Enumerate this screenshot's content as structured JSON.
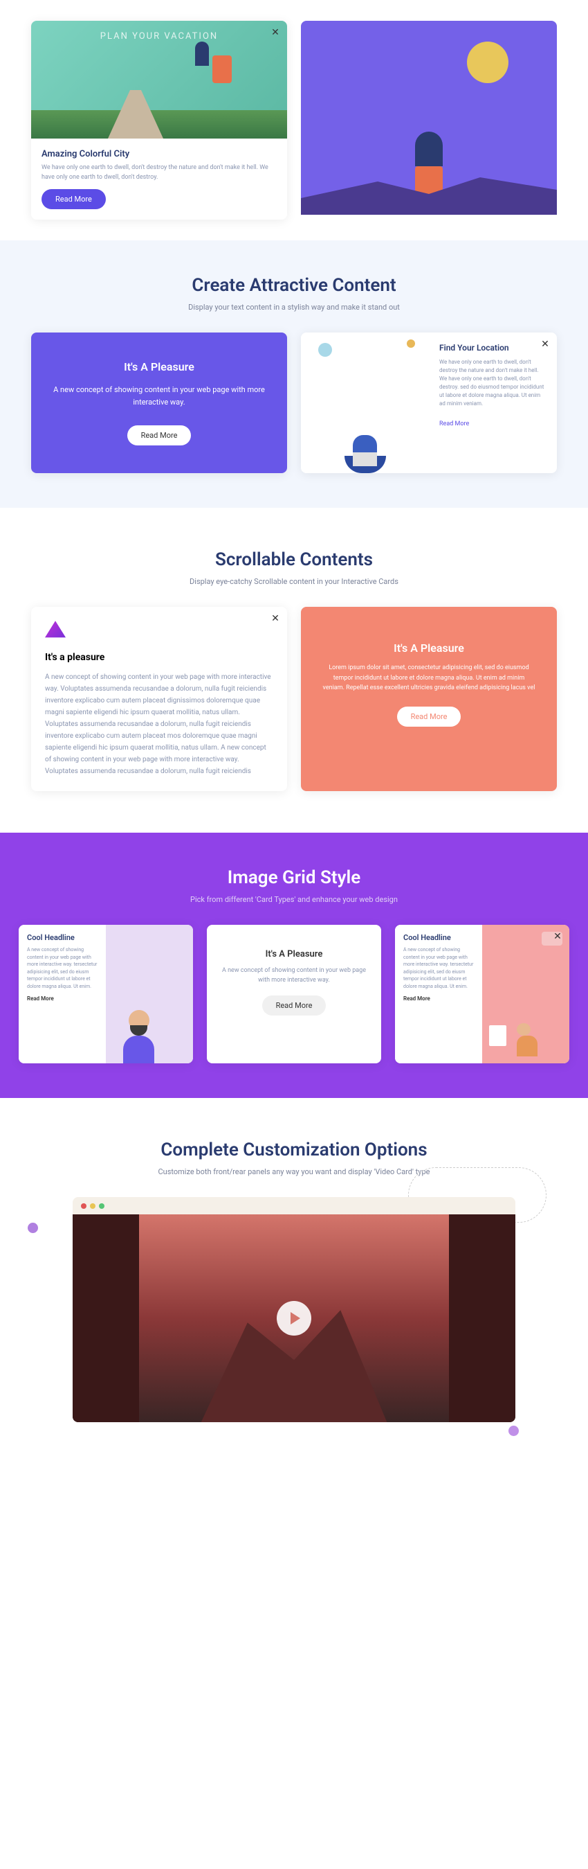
{
  "sec1": {
    "card_a": {
      "overlay": "PLAN YOUR VACATION",
      "title": "Amazing Colorful City",
      "text": "We have only one earth to dwell, don't destroy the nature and don't make it hell. We have only one earth to dwell, don't destroy.",
      "btn": "Read More"
    }
  },
  "sec2": {
    "heading": "Create Attractive Content",
    "sub": "Display your text content in a stylish way and make it stand out",
    "card_a": {
      "title": "It's A Pleasure",
      "text": "A new concept of showing content in your web page with more interactive way.",
      "btn": "Read More"
    },
    "card_b": {
      "title": "Find Your Location",
      "text": "We have only one earth to dwell, don't destroy the nature and don't make it hell. We have only one earth to dwell, don't destroy. sed do eiusmod tempor incididunt ut labore et dolore magna aliqua. Ut enim ad minim veniam.",
      "link": "Read More"
    }
  },
  "sec3": {
    "heading": "Scrollable Contents",
    "sub": "Display eye-catchy Scrollable content in your Interactive Cards",
    "card_a": {
      "title": "It's a pleasure",
      "text": "A new concept of showing content in your web page with more interactive way. Voluptates assumenda recusandae a dolorum, nulla fugit reiciendis inventore explicabo cum autem placeat dignissimos doloremque quae magni sapiente eligendi hic ipsum quaerat mollitia, natus ullam. Voluptates assumenda recusandae a dolorum, nulla fugit reiciendis inventore explicabo cum autem placeat mos doloremque quae magni sapiente eligendi hic ipsum quaerat mollitia, natus ullam. A new concept of showing content in your web page with more interactive way. Voluptates assumenda recusandae a dolorum, nulla fugit reiciendis"
    },
    "card_b": {
      "title": "It's A Pleasure",
      "text": "Lorem ipsum dolor sit amet, consectetur adipisicing elit, sed do eiusmod tempor incididunt ut labore et dolore magna aliqua. Ut enim ad minim veniam. Repellat esse excellent ultricies gravida eleifend adipisicing lacus vel",
      "btn": "Read More"
    }
  },
  "sec4": {
    "heading": "Image Grid Style",
    "sub": "Pick from different 'Card Types' and enhance your web design",
    "card_a": {
      "title": "Cool Headline",
      "text": "A new concept of showing content in your web page with more interactive way. tersectetur adipisicing elit, sed do eiusm tempor incididunt ut labore et dolore magna aliqua. Ut enim.",
      "link": "Read More"
    },
    "card_b": {
      "title": "It's A Pleasure",
      "text": "A new concept of showing content in your web page with more interactive way.",
      "btn": "Read More"
    },
    "card_c": {
      "title": "Cool Headline",
      "text": "A new concept of showing content in your web page with more interactive way. tersectetur adipisicing elit, sed do eiusm tempor incididunt ut labore et dolore magna aliqua. Ut enim.",
      "link": "Read More"
    }
  },
  "sec5": {
    "heading": "Complete Customization Options",
    "sub": "Customize both front/rear panels any way you want and display 'Video Card' type"
  }
}
